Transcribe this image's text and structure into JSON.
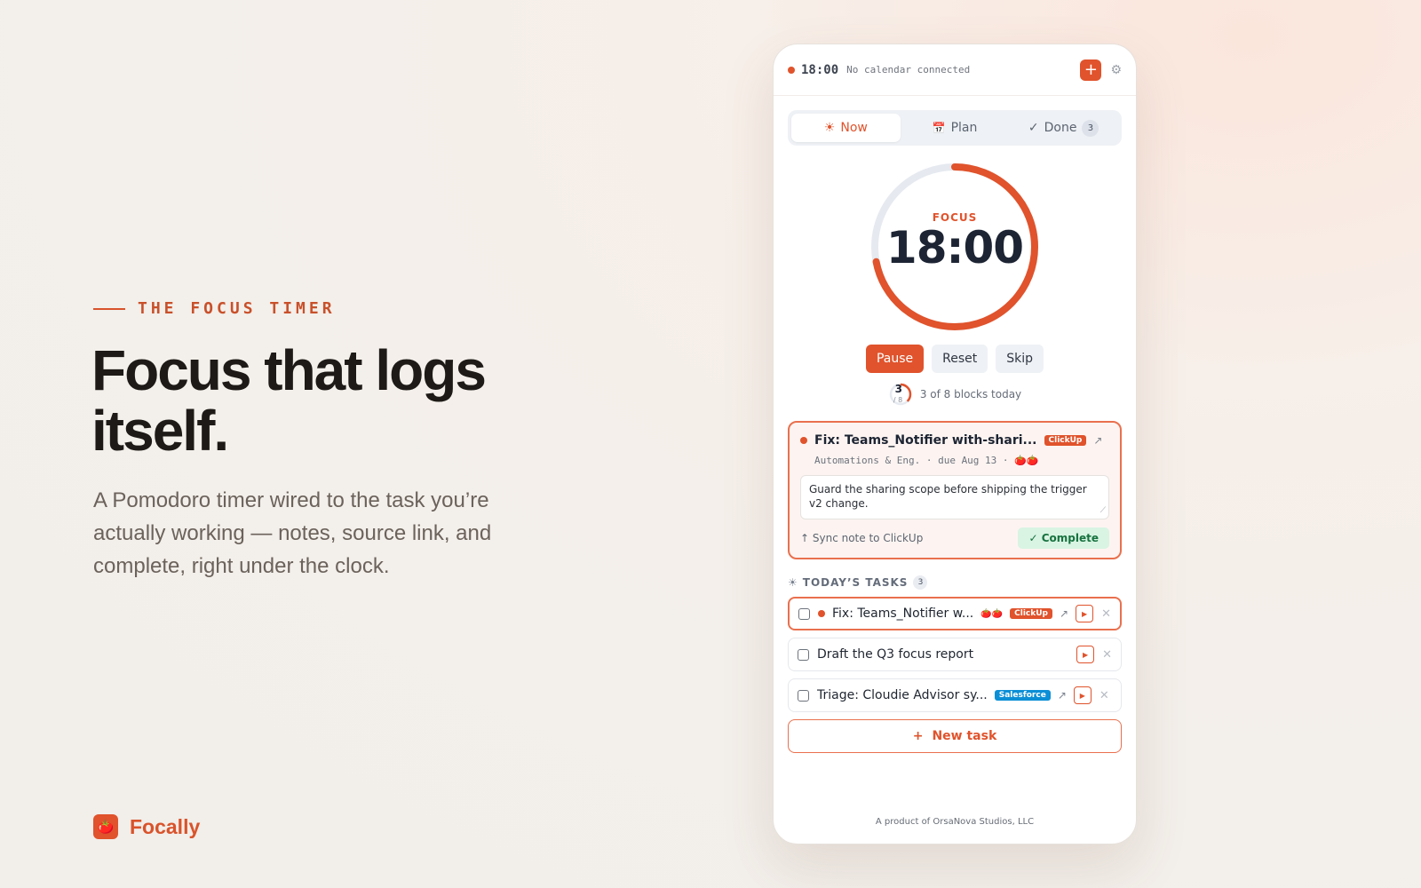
{
  "marketing": {
    "eyebrow": "THE FOCUS TIMER",
    "headline": "Focus that logs itself.",
    "subcopy": "A Pomodoro timer wired to the task you’re actually working — notes, source link, and complete, right under the clock.",
    "brand_name": "Focally",
    "brand_icon": "tomato-icon"
  },
  "app": {
    "topbar": {
      "time": "18:00",
      "calendar_status": "No calendar connected",
      "add_label": "+",
      "settings_icon": "gear-icon"
    },
    "tabs": [
      {
        "label": "Now",
        "icon": "sun-icon",
        "glyph": "☀",
        "active": true
      },
      {
        "label": "Plan",
        "icon": "calendar-icon",
        "glyph": "📅",
        "active": false
      },
      {
        "label": "Done",
        "icon": "check-icon",
        "glyph": "✓",
        "active": false,
        "count": "3"
      }
    ],
    "timer": {
      "label": "FOCUS",
      "time": "18:00",
      "progress": 0.72
    },
    "controls": {
      "pause": "Pause",
      "reset": "Reset",
      "skip": "Skip"
    },
    "blocks": {
      "done": "3",
      "total": "/ 8",
      "text": "3 of 8 blocks today",
      "progress": 0.375
    },
    "current_task": {
      "title": "Fix: Teams_Notifier with-shari...",
      "source": "ClickUp",
      "meta": "Automations & Eng. · due Aug 13 ·",
      "pomodoros": "🍅🍅",
      "note": "Guard the sharing scope before shipping the trigger v2 change.",
      "sync_label": "↑ Sync note to ClickUp",
      "complete_label": "✓ Complete"
    },
    "todays_tasks": {
      "title": "TODAY’S TASKS",
      "count": "3",
      "items": [
        {
          "title": "Fix: Teams_Notifier w...",
          "pomodoros": "🍅🍅",
          "source": "ClickUp",
          "current": true
        },
        {
          "title": "Draft the Q3 focus report",
          "current": false
        },
        {
          "title": "Triage: Cloudie Advisor sy...",
          "source": "Salesforce",
          "current": false
        }
      ]
    },
    "new_task_label": "New task",
    "new_task_icon": "+",
    "footer": "A product of OrsaNova Studios, LLC",
    "colors": {
      "accent": "#e0532c",
      "salesforce": "#0b8fd6",
      "complete_bg": "#d9f4e3"
    }
  }
}
